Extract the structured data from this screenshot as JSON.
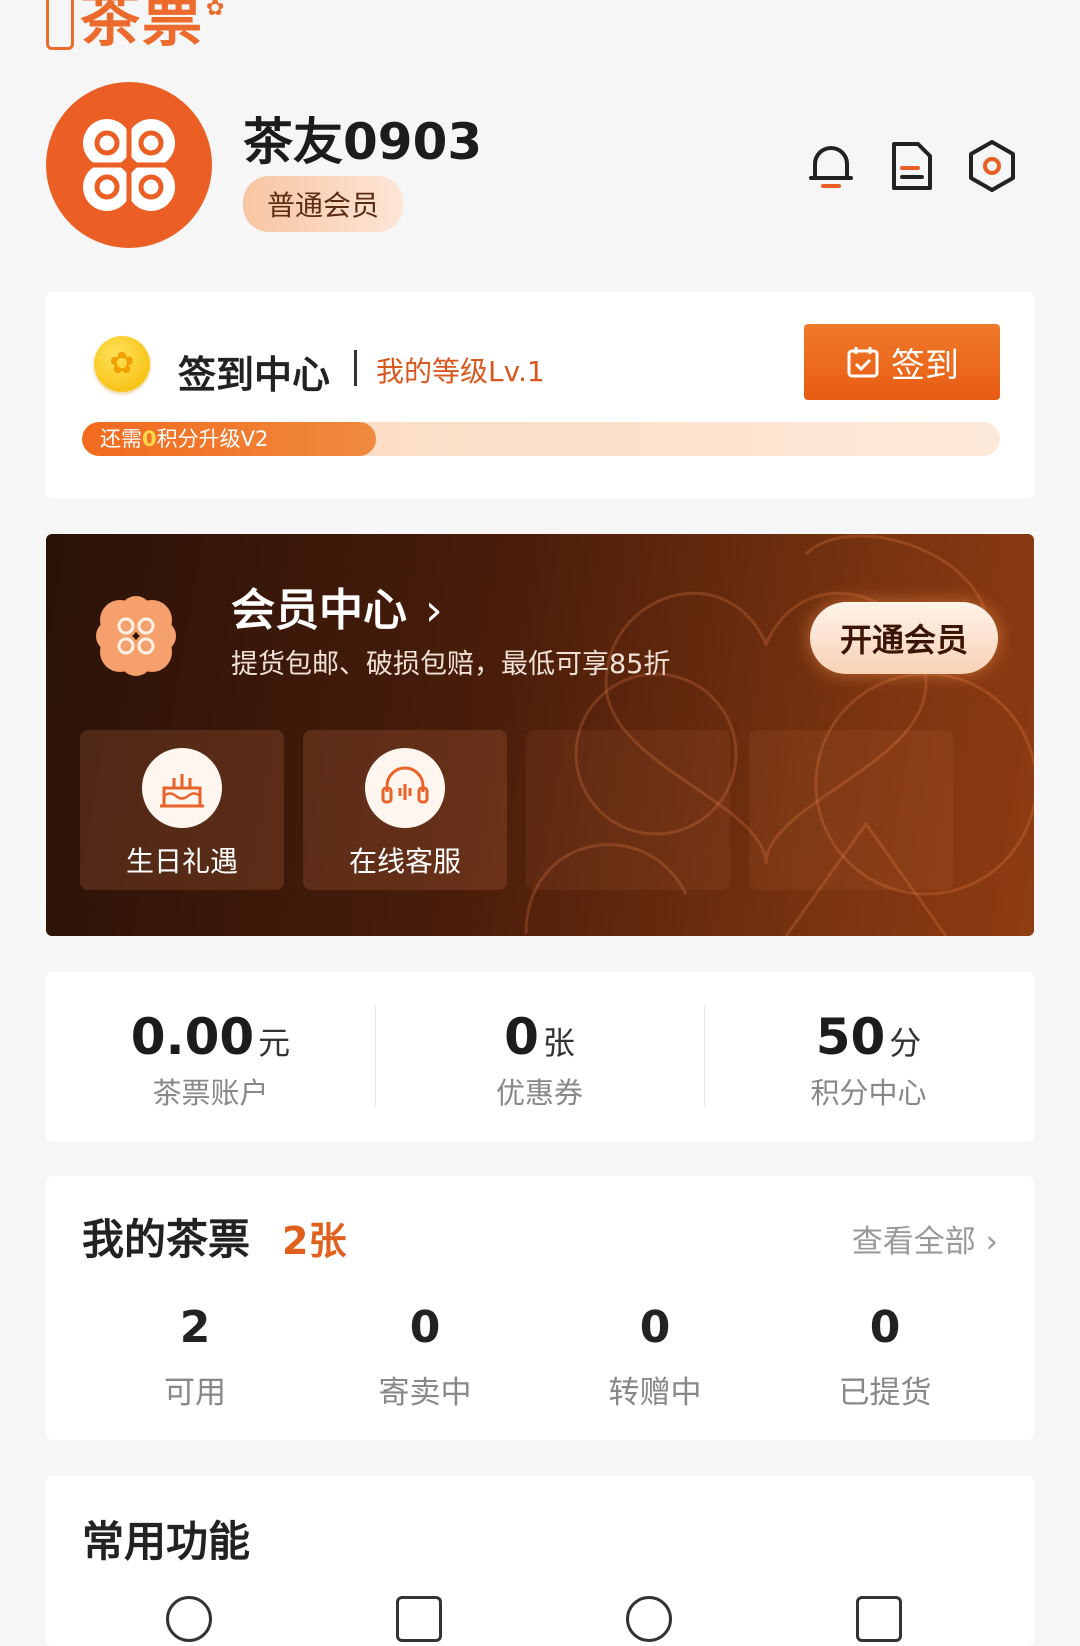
{
  "logo": {
    "text": "茶票"
  },
  "profile": {
    "username": "茶友0903",
    "member_level": "普通会员"
  },
  "header_icons": [
    "bell-icon",
    "document-icon",
    "settings-hexagon-icon"
  ],
  "signin": {
    "title": "签到中心",
    "level": "我的等级Lv.1",
    "button": "签到",
    "progress_prefix": "还需",
    "progress_points": "0",
    "progress_suffix": "积分升级V2",
    "progress_fraction": 0.2
  },
  "member": {
    "title": "会员中心",
    "subtitle": "提货包邮、破损包赔，最低可享85折",
    "cta": "开通会员",
    "perks": [
      {
        "label": "生日礼遇",
        "icon": "cake-icon"
      },
      {
        "label": "在线客服",
        "icon": "headset-icon"
      },
      {
        "label": "",
        "icon": ""
      },
      {
        "label": "",
        "icon": ""
      }
    ]
  },
  "stats": [
    {
      "value": "0.00",
      "unit": "元",
      "label": "茶票账户"
    },
    {
      "value": "0",
      "unit": "张",
      "label": "优惠券"
    },
    {
      "value": "50",
      "unit": "分",
      "label": "积分中心"
    }
  ],
  "tickets": {
    "title": "我的茶票",
    "count": "2张",
    "view_all": "查看全部 ›",
    "items": [
      {
        "value": "2",
        "label": "可用"
      },
      {
        "value": "0",
        "label": "寄卖中"
      },
      {
        "value": "0",
        "label": "转赠中"
      },
      {
        "value": "0",
        "label": "已提货"
      }
    ]
  },
  "common": {
    "title": "常用功能"
  },
  "colors": {
    "accent": "#ec5f24",
    "dark_card": "#3a1608",
    "text_muted": "#888888"
  }
}
